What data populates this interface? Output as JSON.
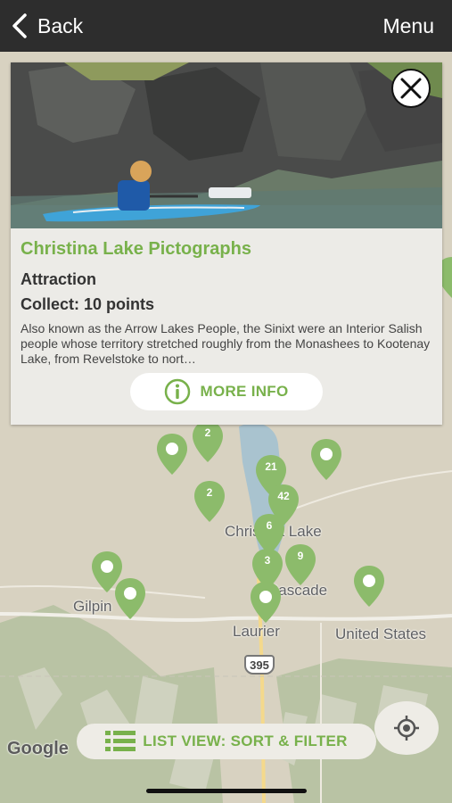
{
  "header": {
    "back_label": "Back",
    "menu_label": "Menu"
  },
  "card": {
    "title": "Christina Lake Pictographs",
    "category": "Attraction",
    "points": "Collect: 10 points",
    "description": "Also known as the Arrow Lakes People, the Sinixt were an Interior Salish people whose territory stretched roughly from the Monashees to Kootenay Lake, from Revelstoke to nort…",
    "more_info_label": "MORE INFO"
  },
  "map": {
    "labels": {
      "christina_lake": "Christina Lake",
      "cascade": "Cascade",
      "gilpin": "Gilpin",
      "laurier": "Laurier",
      "united_states": "United States",
      "highway": "395"
    },
    "pins": [
      "2",
      "2",
      "21",
      "42",
      "6",
      "3",
      "9"
    ],
    "google_logo": "Google"
  },
  "bottom": {
    "list_view_label": "LIST VIEW: SORT & FILTER"
  },
  "colors": {
    "accent": "#78b14b",
    "pin": "#8cbb6b",
    "topbar": "#2d2d2d"
  }
}
